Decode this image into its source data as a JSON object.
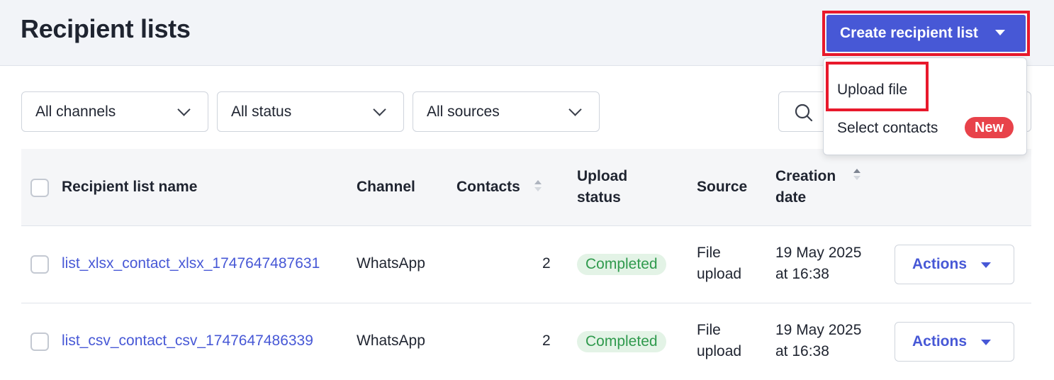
{
  "header": {
    "title": "Recipient lists",
    "create_button": "Create recipient list"
  },
  "create_menu": {
    "items": [
      {
        "label": "Upload file"
      },
      {
        "label": "Select contacts",
        "badge": "New"
      }
    ]
  },
  "filters": [
    {
      "label": "All channels"
    },
    {
      "label": "All status"
    },
    {
      "label": "All sources"
    }
  ],
  "table": {
    "columns": {
      "name": "Recipient list name",
      "channel": "Channel",
      "contacts": "Contacts",
      "upload_status_1": "Upload",
      "upload_status_2": "status",
      "source": "Source",
      "creation_date_1": "Creation",
      "creation_date_2": "date"
    },
    "rows": [
      {
        "name": "list_xlsx_contact_xlsx_1747647487631",
        "channel": "WhatsApp",
        "contacts": "2",
        "status": "Completed",
        "source_1": "File",
        "source_2": "upload",
        "date_1": "19 May 2025",
        "date_2": "at 16:38",
        "action": "Actions"
      },
      {
        "name": "list_csv_contact_csv_1747647486339",
        "channel": "WhatsApp",
        "contacts": "2",
        "status": "Completed",
        "source_1": "File",
        "source_2": "upload",
        "date_1": "19 May 2025",
        "date_2": "at 16:38",
        "action": "Actions"
      }
    ]
  },
  "colors": {
    "primary": "#4758d6",
    "highlight": "#e8192c",
    "success_bg": "#e3f3e6",
    "success_text": "#2f9a4d",
    "badge_new": "#e8424a"
  },
  "icons": {
    "search": "search-icon",
    "dropdown": "chevron-down-icon",
    "sort": "sort-icon"
  }
}
